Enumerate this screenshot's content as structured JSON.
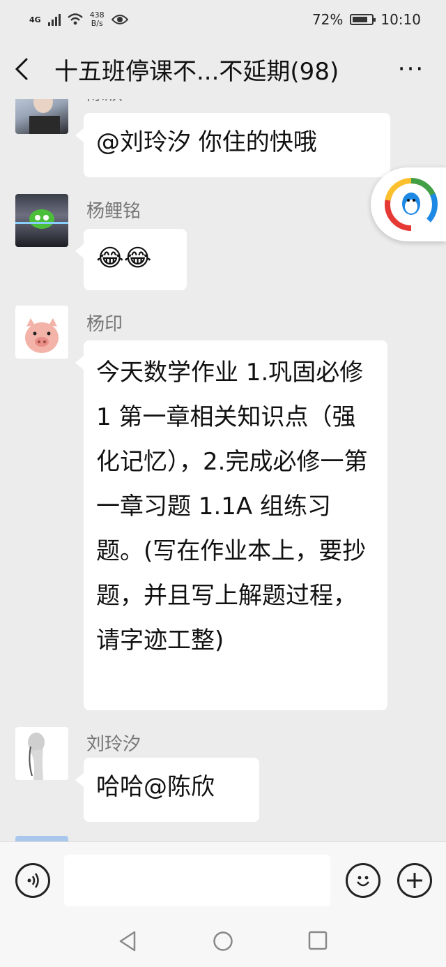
{
  "status_bar": {
    "network": "4G",
    "speed_value": "438",
    "speed_unit": "B/s",
    "battery": "72%",
    "time": "10:10"
  },
  "header": {
    "title": "十五班停课不...不延期(98)",
    "more_label": "···"
  },
  "messages": [
    {
      "sender": "陈欣",
      "text": "@刘玲汐  你住的快哦"
    },
    {
      "sender": "杨鲤铭",
      "text": "😂😂"
    },
    {
      "sender": "杨印",
      "text": "今天数学作业 1.巩固必修 1 第一章相关知识点（强化记忆），2.完成必修一第一章习题 1.1A 组练习题。(写在作业本上，要抄题，并且写上解题过程，请字迹工整)"
    },
    {
      "sender": "刘玲汐",
      "text": "哈哈@陈欣"
    }
  ],
  "input_bar": {
    "placeholder": ""
  },
  "colors": {
    "background": "#ececec",
    "bubble": "#ffffff",
    "sender_text": "#777777"
  }
}
